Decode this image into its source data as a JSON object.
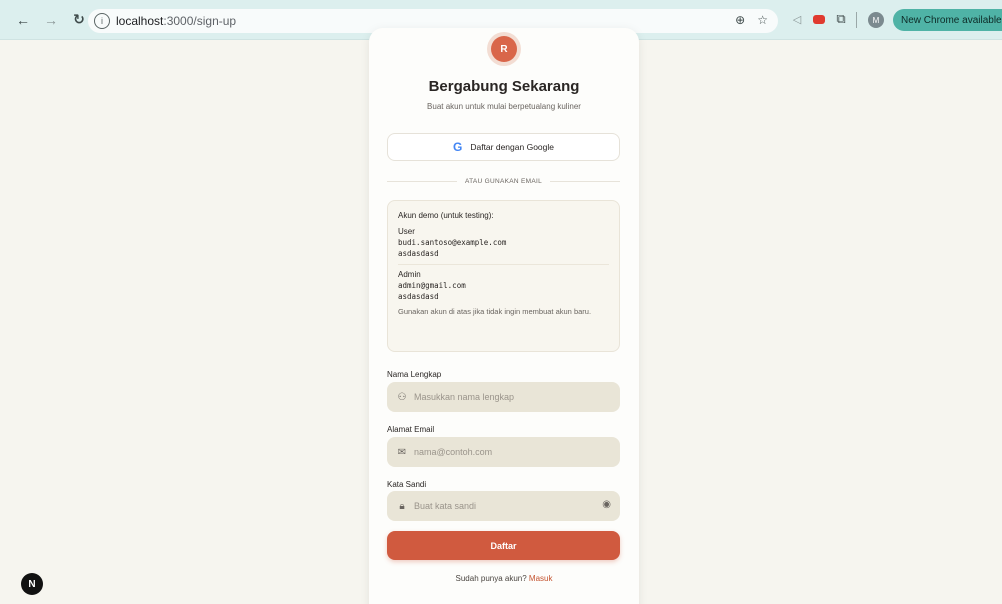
{
  "browser": {
    "url_host": "localhost",
    "url_path": ":3000/sign-up",
    "update_label": "New Chrome available"
  },
  "brand": {
    "logo_letter": "R"
  },
  "page": {
    "title": "Bergabung Sekarang",
    "subtitle": "Buat akun untuk mulai berpetualang kuliner",
    "google_button": "Daftar dengan Google",
    "divider": "ATAU GUNAKAN EMAIL"
  },
  "demo": {
    "heading": "Akun demo (untuk testing):",
    "user": {
      "role": "User",
      "email": "budi.santoso@example.com",
      "password": "asdasdasd"
    },
    "admin": {
      "role": "Admin",
      "email": "admin@gmail.com",
      "password": "asdasdasd"
    },
    "note": "Gunakan akun di atas jika tidak ingin membuat akun baru."
  },
  "form": {
    "name_label": "Nama Lengkap",
    "name_placeholder": "Masukkan nama lengkap",
    "email_label": "Alamat Email",
    "email_placeholder": "nama@contoh.com",
    "password_label": "Kata Sandi",
    "password_placeholder": "Buat kata sandi",
    "submit_label": "Daftar"
  },
  "footer": {
    "signin_prompt": "Sudah punya akun?",
    "signin_link": "Masuk"
  },
  "dev_badge": "N",
  "colors": {
    "accent": "#d05a3f",
    "input_bg": "#e9e5d7",
    "chrome": "#dcefee"
  }
}
